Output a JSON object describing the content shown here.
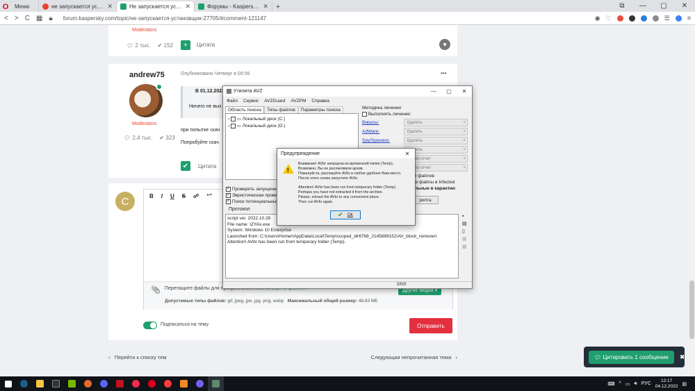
{
  "browser": {
    "tabs": [
      {
        "label": "Меню",
        "icon": "opera-icon"
      },
      {
        "label": "не запускается установщ",
        "icon": "yandex-icon"
      },
      {
        "label": "Не запускается установщ",
        "icon": "kaspersky-icon",
        "active": true
      },
      {
        "label": "Форумы - Kaspersky Supp",
        "icon": "kaspersky-icon"
      }
    ],
    "new_tab": "+",
    "url": "forum.kaspersky.com/topic/не-запускается-установщик-27705/#comment-121147",
    "window_controls": [
      "⧉",
      "—",
      "▢",
      "✕"
    ]
  },
  "posts": {
    "prev_post": {
      "role": "Moderators",
      "replies": "2 тыс.",
      "reactions": "152",
      "quote": "Цитата"
    },
    "post": {
      "author": "andrew75",
      "meta": "Опубликовано Четверг в 09:56",
      "more": "•••",
      "quote_head": "В 01.12.2022 в",
      "quote_body": "Ничего не вых",
      "line1": "при попытке скач",
      "line2": "Попробуйте скач",
      "role": "Moderators",
      "replies": "2,4 тыс.",
      "reactions": "323",
      "quote": "Цитата"
    }
  },
  "editor": {
    "avatar_letter": "C",
    "toolbar": [
      "B",
      "I",
      "U",
      "S",
      "☍",
      "“”"
    ],
    "attach_text": "Перетащите файлы для прикрепления, или ",
    "attach_link": "выберите файлы...",
    "types_label": "Допустимые типы файлов:",
    "types_value": "gif, jpeg, jpe, jpg, png, webp",
    "max_label": "Максимальный общий размер:",
    "max_value": "48.83 МБ",
    "other_media": "Другие медиа ▾",
    "subscribe": "Подписаться на тему",
    "send": "Отправить"
  },
  "pager": {
    "prev": "Перейти к списку тем",
    "next": "Следующая непрочитанная тема"
  },
  "avz": {
    "title": "Утилита AVZ",
    "menu": [
      "Файл",
      "Сервис",
      "AVZGuard",
      "AVZPM",
      "Справка"
    ],
    "tabs": [
      "Область поиска",
      "Типы файлов",
      "Параметры поиска"
    ],
    "drives": [
      "Локальный диск (C:)",
      "Локальный диск (D:)"
    ],
    "options": [
      "Проверять запущенны",
      "Эвристическая провер",
      "Поиск потенциальных"
    ],
    "protocol_label": "Протокол",
    "log": [
      "script ver.  2022.10.28",
      "File name: IZYAx.exe",
      "System: Windows 10 Enterprise",
      "Launched from: C:\\Users\\Homer\\AppData\\Local\\Temp\\scoped_dir6768_2145889152\\AV_block_remover\\",
      "Attention! AVbr has been run from temporary folder (Temp)."
    ],
    "method_label": "Методика лечения",
    "perform_label": "Выполнять лечение:",
    "methods": [
      {
        "name": "Вирусы:",
        "value": "Удалять"
      },
      {
        "name": "AdWare:",
        "value": "Удалять"
      },
      {
        "name": "Spy/Spyware:",
        "value": "Удалять"
      },
      {
        "name": "",
        "value": "Удалять"
      },
      {
        "name": "",
        "value": "только отчет"
      },
      {
        "name": "",
        "value": "только отчет"
      }
    ],
    "right_tail": [
      "ки файлов",
      "ые файлы в  Infected",
      "ельные в  карантин"
    ],
    "script_btn": "рипта",
    "status": "0/0/0"
  },
  "dialog": {
    "title": "Предупреждение",
    "close": "✕",
    "text_ru": [
      "Внимание! AVbr запущена из временной папки (Temp).",
      "Возможно, Вы не распаковали архив.",
      "Пожалуйста, распакуйте AVbr в любое удобное Вам место.",
      "После этого снова запустите AVbr."
    ],
    "text_en": [
      "Attention! AVbr has been run from temporary folder (Temp).",
      "Perhaps you have not extracted it from the archive.",
      "Please, extract the AVbr to any convenient place.",
      "Then run AVbr again."
    ],
    "ok": "Ok"
  },
  "notice": {
    "cite_label": "Цитировать 1 сообщение",
    "close": "✖"
  },
  "taskbar": {
    "lang": "РУС",
    "time": "12:17",
    "date": "04.12.2022"
  }
}
